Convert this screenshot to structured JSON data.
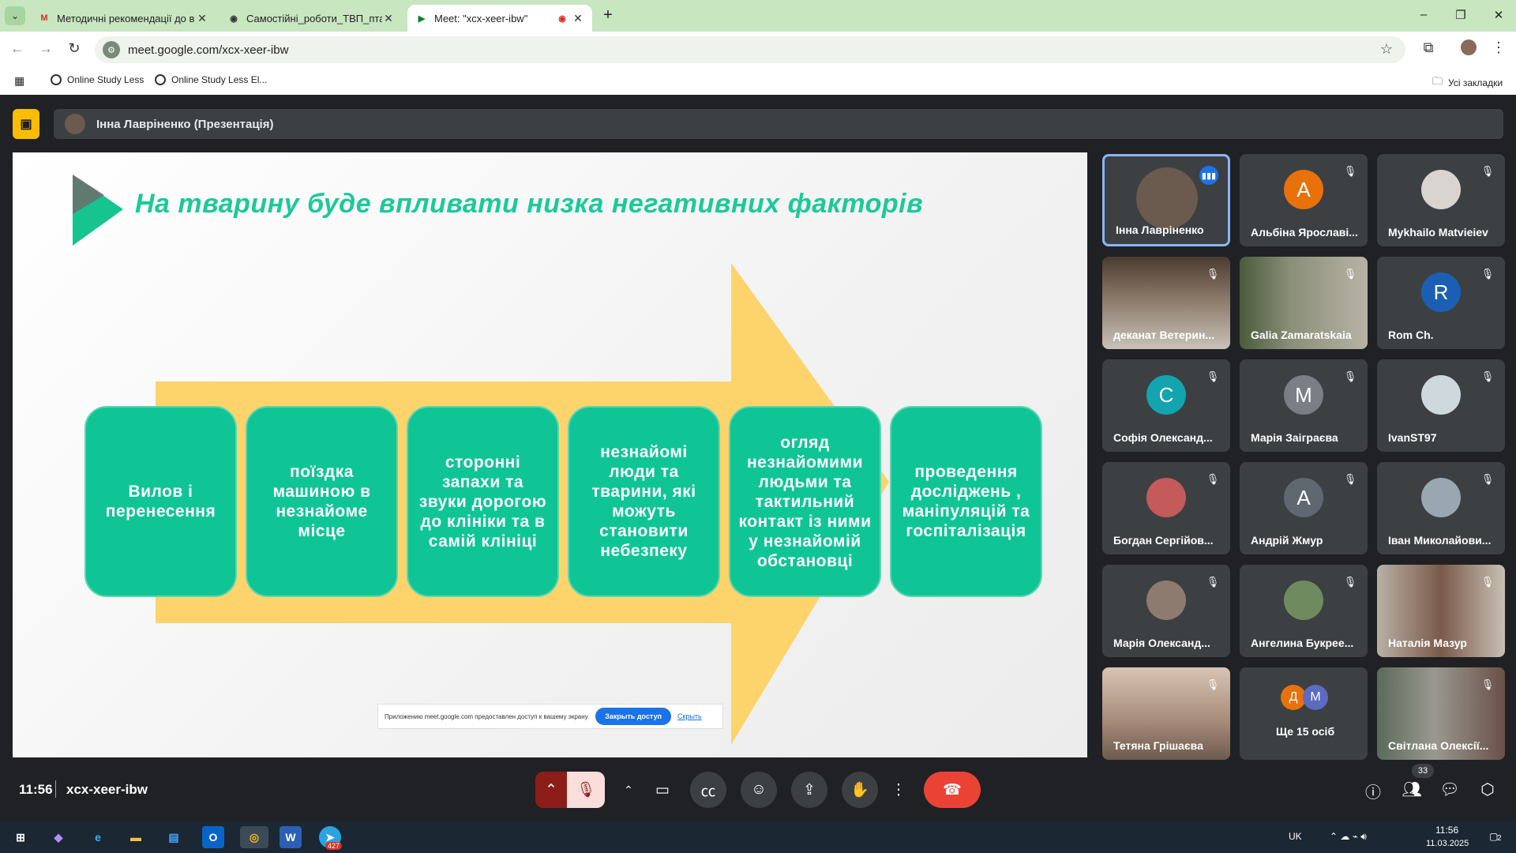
{
  "browser": {
    "tabs": [
      {
        "title": "Методичні рекомендації до в",
        "icon": "gmail-icon"
      },
      {
        "title": "Самостійні_роботи_ТВП_птахі",
        "icon": "globe-icon"
      },
      {
        "title": "Meet: \"xcx-xeer-ibw\"",
        "icon": "meet-icon"
      }
    ],
    "url": "meet.google.com/xcx-xeer-ibw",
    "bookmarks": [
      {
        "label": "Online Study Less"
      },
      {
        "label": "Online Study Less El..."
      }
    ],
    "all_bookmarks": "Усі закладки"
  },
  "presentation": {
    "presenter": "Інна Лавріненко (Презентація)",
    "slide_title": "На тварину буде впливати низка негативних факторів",
    "boxes": [
      "Вилов і перенесення",
      "поїздка машиною в незнайоме місце",
      "сторонні запахи та звуки дорогою до клініки та в самій клініці",
      "незнайомі люди та тварини, які можуть становити небезпеку",
      "огляд незнайомими людьми та тактильний контакт із ними у незнайомій обстановці",
      "проведення досліджень , маніпуляцій та госпіталізація"
    ],
    "share_notice": "Приложению meet.google.com предоставлен доступ к вашему экрану.",
    "stop_share": "Закрыть доступ",
    "hide": "Скрыть"
  },
  "participants": [
    {
      "name": "Інна Лавріненко"
    },
    {
      "name": "Альбіна Ярославі..."
    },
    {
      "name": "Mykhailo Matvieiev"
    },
    {
      "name": "деканат Ветерин..."
    },
    {
      "name": "Galia Zamaratskaia"
    },
    {
      "name": "Rom Ch."
    },
    {
      "name": "Софія Олександ..."
    },
    {
      "name": "Марія Заіграєва"
    },
    {
      "name": "IvanST97"
    },
    {
      "name": "Богдан Сергійов..."
    },
    {
      "name": "Андрій Жмур"
    },
    {
      "name": "Іван Миколайови..."
    },
    {
      "name": "Марія Олександ..."
    },
    {
      "name": "Ангелина Букрее..."
    },
    {
      "name": "Наталія Мазур"
    },
    {
      "name": "Тетяна Грішаєва"
    },
    {
      "name": "Ще 15 осіб"
    },
    {
      "name": "Світлана Олексії..."
    }
  ],
  "avatars": {
    "albina": "А",
    "rom": "R",
    "sofia": "С",
    "mariaz": "М",
    "andriy": "А",
    "more1": "Д",
    "more2": "М"
  },
  "controls": {
    "time": "11:56",
    "meeting_code": "xcx-xeer-ibw",
    "people_count": "33"
  },
  "taskbar": {
    "lang": "UK",
    "time": "11:56",
    "date": "11.03.2025",
    "telegram_badge": "427",
    "notif": "2"
  },
  "colors": {
    "accent_green": "#0fc596",
    "title_green": "#1cc99a",
    "arrow_yellow": "#fdd46b",
    "end_call_red": "#ea4335"
  }
}
